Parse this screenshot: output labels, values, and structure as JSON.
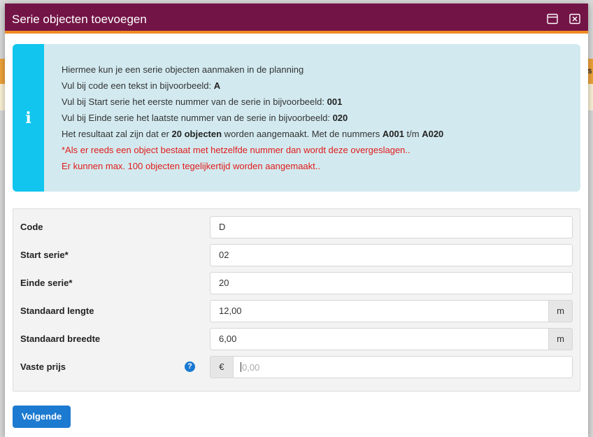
{
  "background": {
    "side_letter": "s"
  },
  "dialog": {
    "title": "Serie objecten toevoegen",
    "maximize_icon": "maximize-icon",
    "close_icon": "close-icon"
  },
  "info": {
    "icon_glyph": "i",
    "line1": "Hiermee kun je een serie objecten aanmaken in de planning",
    "line2_text": "Vul bij code een tekst in bijvoorbeeld: ",
    "line2_bold": "A",
    "line3_text": "Vul bij Start serie het eerste nummer van de serie in bijvoorbeeld: ",
    "line3_bold": "001",
    "line4_text": "Vul bij Einde serie het laatste nummer van de serie in bijvoorbeeld: ",
    "line4_bold": "020",
    "line5_a": "Het resultaat zal zijn dat er ",
    "line5_b": "20 objecten",
    "line5_c": " worden aangemaakt. Met de nummers ",
    "line5_d": "A001",
    "line5_e": " t/m ",
    "line5_f": "A020",
    "line6": "*Als er reeds een object bestaat met hetzelfde nummer dan wordt deze overgeslagen..",
    "line7": "Er kunnen max. 100 objecten tegelijkertijd worden aangemaakt.."
  },
  "form": {
    "code": {
      "label": "Code",
      "value": "D"
    },
    "start": {
      "label": "Start serie*",
      "value": "02"
    },
    "end": {
      "label": "Einde serie*",
      "value": "20"
    },
    "length": {
      "label": "Standaard lengte",
      "value": "12,00",
      "unit": "m"
    },
    "width": {
      "label": "Standaard breedte",
      "value": "6,00",
      "unit": "m"
    },
    "price": {
      "label": "Vaste prijs",
      "prefix": "€",
      "value": "",
      "placeholder": "0,00",
      "help_glyph": "?"
    }
  },
  "buttons": {
    "next": "Volgende"
  }
}
